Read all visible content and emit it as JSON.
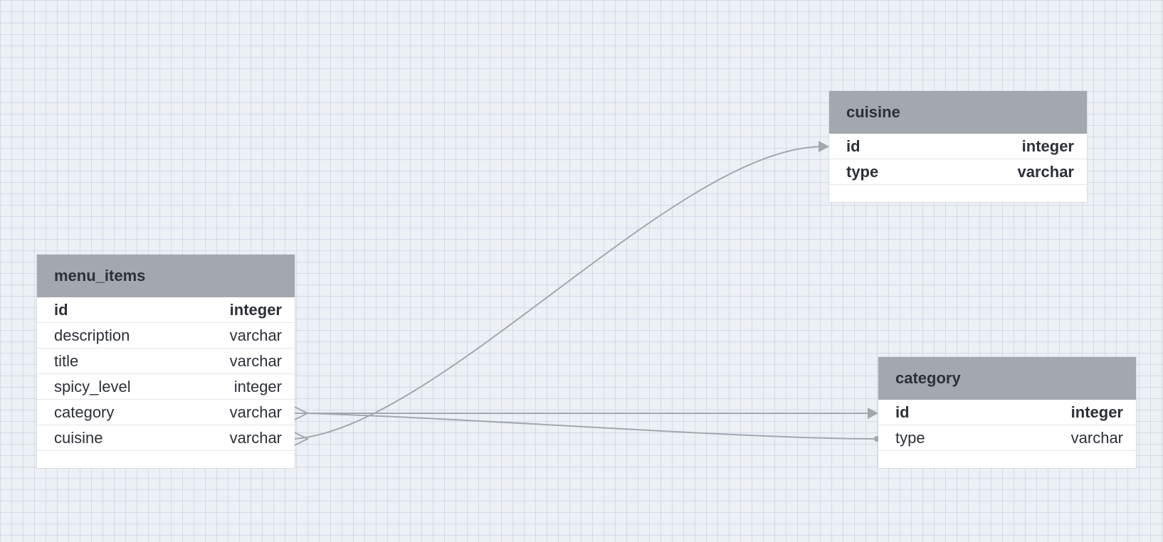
{
  "diagram": {
    "colors": {
      "background": "#edf0f4",
      "grid": "#becde6",
      "header": "#a3a8af",
      "connector": "#a3a8af",
      "text": "#2c3038"
    },
    "tables": {
      "cuisine": {
        "name": "cuisine",
        "columns": [
          {
            "name": "id",
            "type": "integer",
            "key": true
          },
          {
            "name": "type",
            "type": "varchar",
            "key": true
          }
        ]
      },
      "menu_items": {
        "name": "menu_items",
        "columns": [
          {
            "name": "id",
            "type": "integer",
            "key": true
          },
          {
            "name": "description",
            "type": "varchar",
            "key": false
          },
          {
            "name": "title",
            "type": "varchar",
            "key": false
          },
          {
            "name": "spicy_level",
            "type": "integer",
            "key": false
          },
          {
            "name": "category",
            "type": "varchar",
            "key": false
          },
          {
            "name": "cuisine",
            "type": "varchar",
            "key": false
          }
        ]
      },
      "category": {
        "name": "category",
        "columns": [
          {
            "name": "id",
            "type": "integer",
            "key": true
          },
          {
            "name": "type",
            "type": "varchar",
            "key": false
          }
        ]
      }
    },
    "relationships": [
      {
        "from_table": "menu_items",
        "from_column": "cuisine",
        "to_table": "cuisine",
        "to_column": "id",
        "from_end": "crow-foot",
        "to_end": "arrow"
      },
      {
        "from_table": "menu_items",
        "from_column": "category",
        "to_table": "category",
        "to_column": "id",
        "from_end": "crow-foot",
        "to_end": "arrow"
      },
      {
        "from_table": "menu_items",
        "from_column": "category",
        "to_table": "category",
        "to_column": "type",
        "from_end": "crow-foot",
        "to_end": "dot"
      }
    ]
  }
}
